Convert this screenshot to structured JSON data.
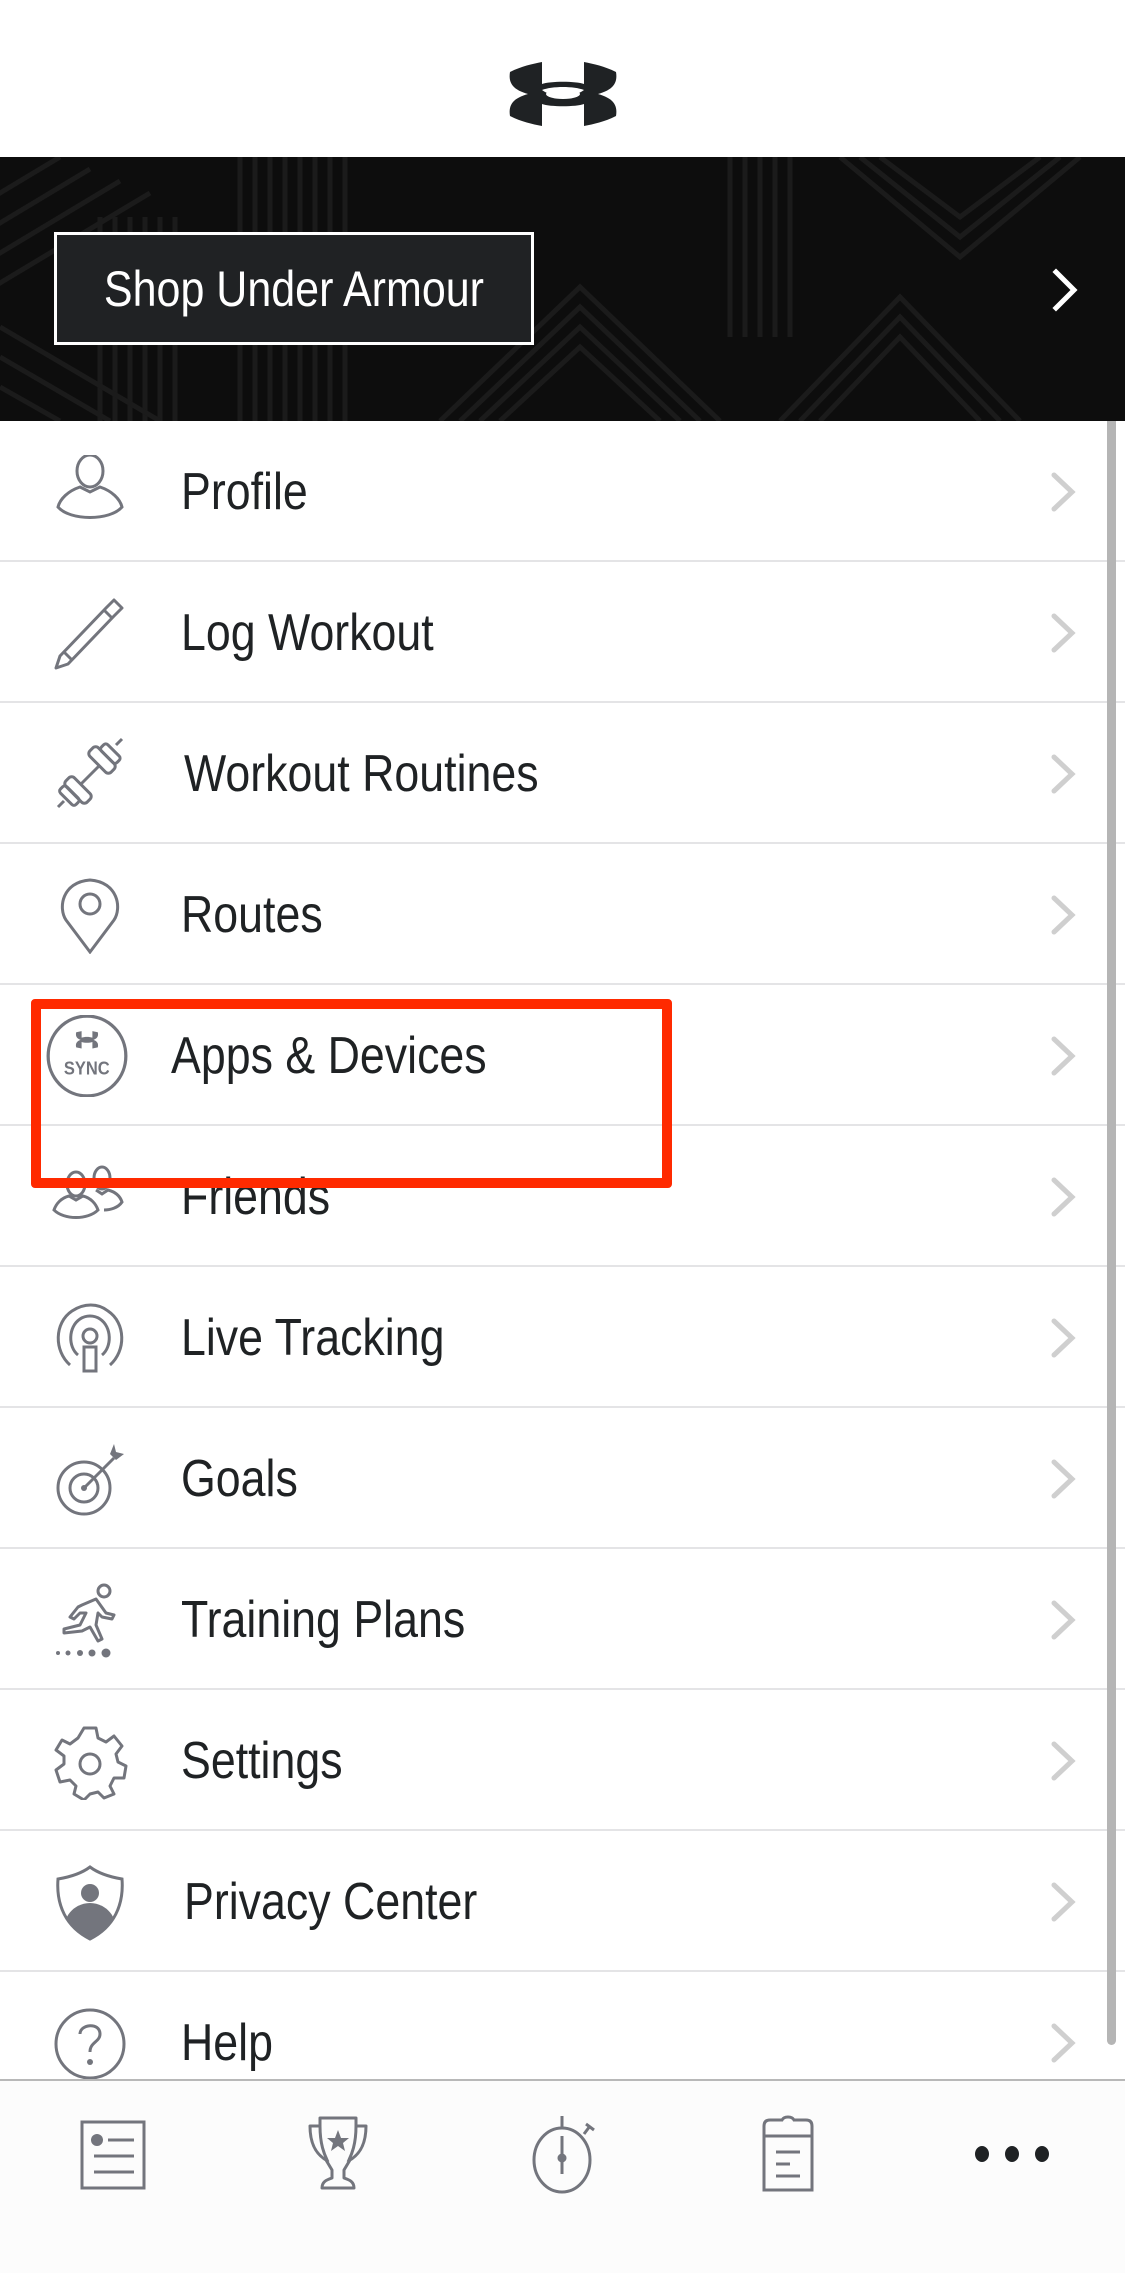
{
  "header": {
    "logo": "under-armour-logo"
  },
  "banner": {
    "button_label": "Shop Under Armour",
    "chevron_icon": "chevron-right-icon"
  },
  "menu": {
    "items": [
      {
        "label": "Profile",
        "icon": "user-icon"
      },
      {
        "label": "Log Workout",
        "icon": "pencil-icon"
      },
      {
        "label": "Workout Routines",
        "icon": "dumbbell-icon"
      },
      {
        "label": "Routes",
        "icon": "map-pin-icon"
      },
      {
        "label": "Apps & Devices",
        "icon": "ua-sync-icon",
        "sync_text": "SYNC",
        "highlighted": true
      },
      {
        "label": "Friends",
        "icon": "friends-icon"
      },
      {
        "label": "Live Tracking",
        "icon": "live-tracking-icon"
      },
      {
        "label": "Goals",
        "icon": "target-icon"
      },
      {
        "label": "Training Plans",
        "icon": "runner-icon"
      },
      {
        "label": "Settings",
        "icon": "gear-icon"
      },
      {
        "label": "Privacy Center",
        "icon": "shield-user-icon"
      },
      {
        "label": "Help",
        "icon": "help-icon"
      }
    ]
  },
  "tabbar": {
    "tabs": [
      {
        "name": "feed",
        "icon": "feed-icon",
        "active": false
      },
      {
        "name": "challenges",
        "icon": "trophy-icon",
        "active": false
      },
      {
        "name": "record",
        "icon": "stopwatch-icon",
        "active": false
      },
      {
        "name": "plans",
        "icon": "clipboard-icon",
        "active": false
      },
      {
        "name": "more",
        "icon": "more-icon",
        "active": true
      }
    ]
  },
  "colors": {
    "highlight": "#ff2a00",
    "icon_gray": "#73757d",
    "text": "#1f2224",
    "banner_bg": "#0d0d0d",
    "chevron_gray": "#cfcfcf"
  }
}
